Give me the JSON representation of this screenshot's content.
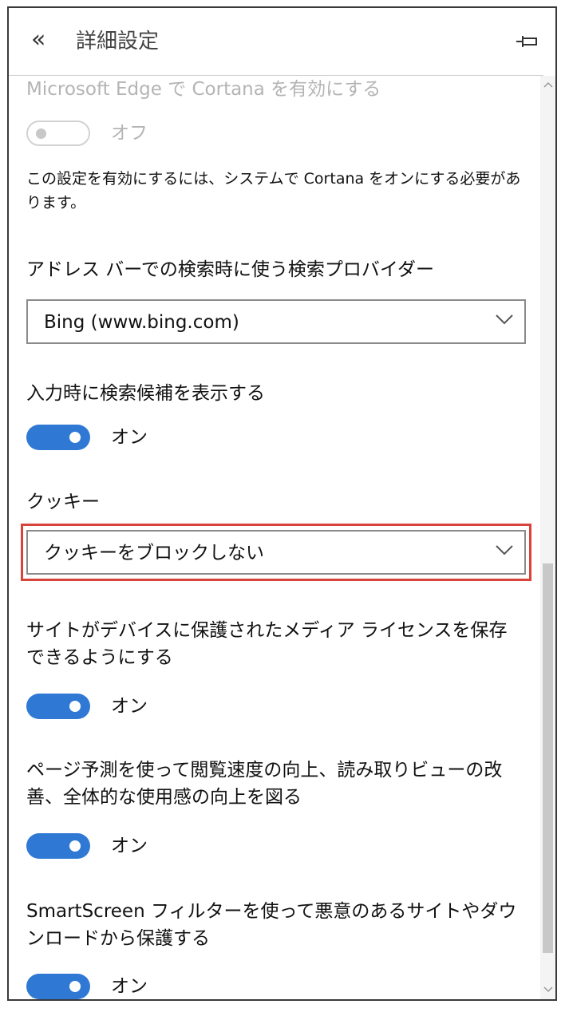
{
  "header": {
    "back_icon": "«",
    "title": "詳細設定",
    "pin_icon": "pin-icon"
  },
  "cortana": {
    "label": "Microsoft Edge で Cortana を有効にする",
    "state": "オフ",
    "note": "この設定を有効にするには、システムで Cortana をオンにする必要があります。"
  },
  "search_provider": {
    "label": "アドレス バーでの検索時に使う検索プロバイダー",
    "value": "Bing (www.bing.com)"
  },
  "suggestions": {
    "label": "入力時に検索候補を表示する",
    "state": "オン"
  },
  "cookies": {
    "label": "クッキー",
    "value": "クッキーをブロックしない"
  },
  "media_license": {
    "label": "サイトがデバイスに保護されたメディア ライセンスを保存できるようにする",
    "state": "オン"
  },
  "page_prediction": {
    "label": "ページ予測を使って閲覧速度の向上、読み取りビューの改善、全体的な使用感の向上を図る",
    "state": "オン"
  },
  "smartscreen": {
    "label": "SmartScreen フィルターを使って悪意のあるサイトやダウンロードから保護する",
    "state": "オン"
  },
  "colors": {
    "toggle_on": "#2f79d5",
    "highlight": "#d9443a"
  }
}
